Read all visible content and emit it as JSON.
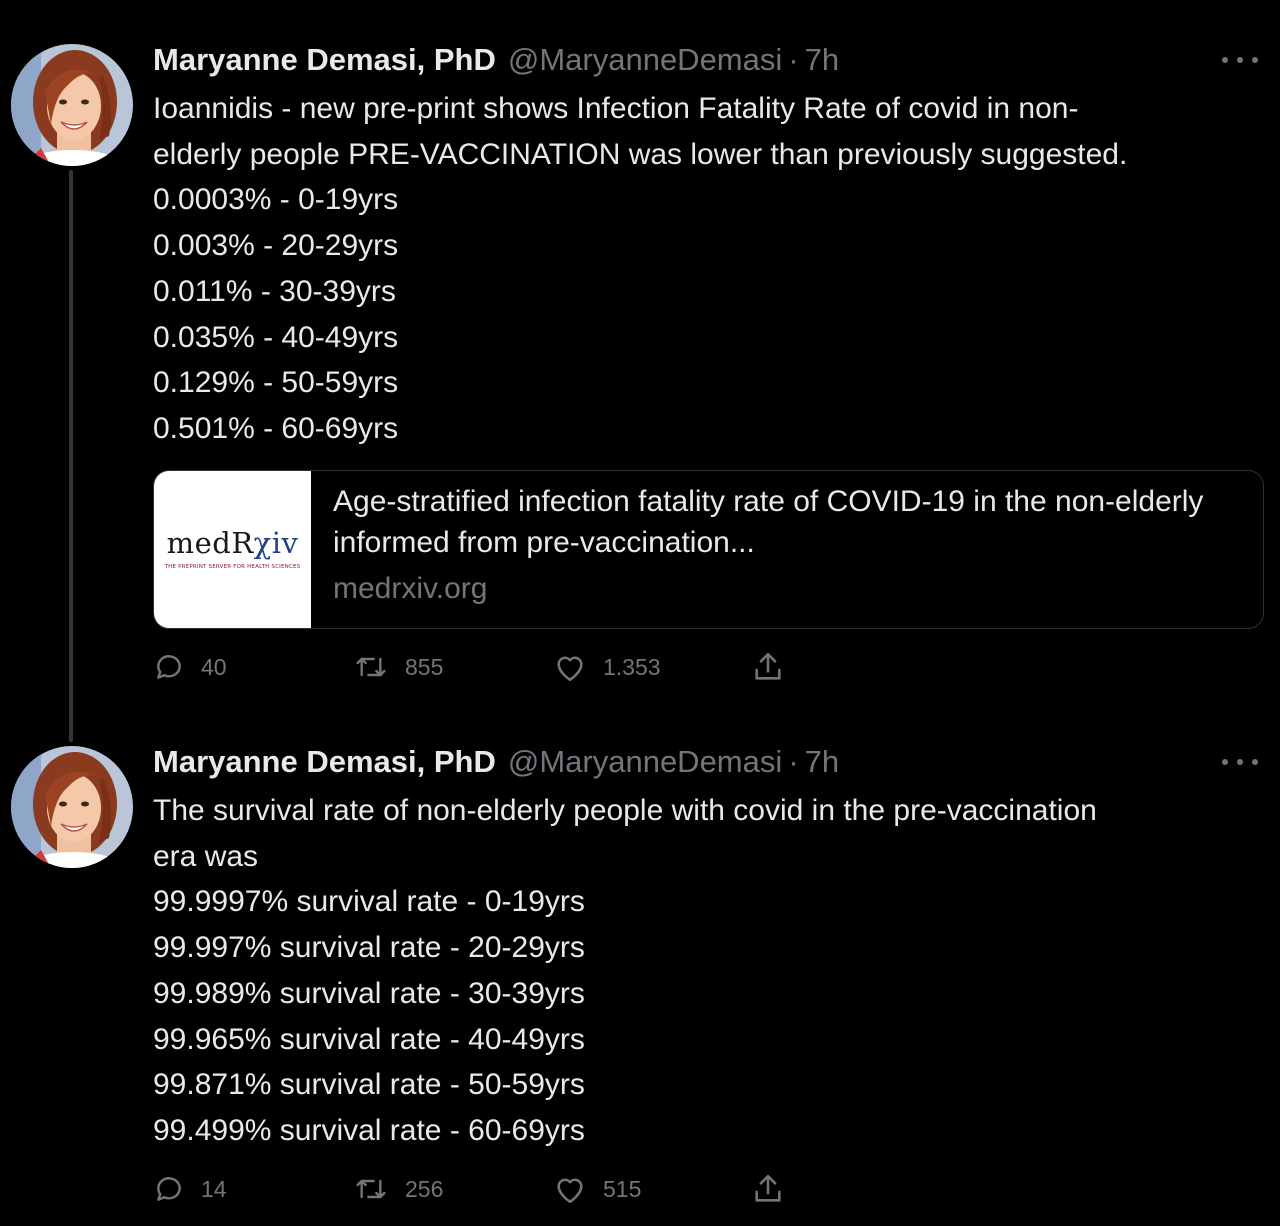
{
  "colors": {
    "background": "#000000",
    "text_primary": "#e7e9ea",
    "text_secondary": "#71767b",
    "border": "#2f3336",
    "thread_line": "#333639"
  },
  "tweets": [
    {
      "author_name": "Maryanne Demasi, PhD",
      "handle": "@MaryanneDemasi",
      "dot": "·",
      "time": "7h",
      "text_lines": [
        "Ioannidis - new pre-print shows Infection Fatality Rate of covid in non-",
        "elderly people PRE-VACCINATION was lower than previously suggested.",
        "0.0003% - 0-19yrs",
        "0.003% - 20-29yrs",
        "0.011% - 30-39yrs",
        "0.035% - 40-49yrs",
        "0.129% - 50-59yrs",
        "0.501% - 60-69yrs"
      ],
      "card": {
        "logo_main": "medR",
        "logo_accent": "χiv",
        "logo_sub": "THE PREPRINT SERVER FOR HEALTH SCIENCES",
        "title": "Age-stratified infection fatality rate of COVID-19 in the non-elderly informed from pre-vaccination...",
        "domain": "medrxiv.org"
      },
      "replies": "40",
      "retweets": "855",
      "likes": "1.353"
    },
    {
      "author_name": "Maryanne Demasi, PhD",
      "handle": "@MaryanneDemasi",
      "dot": "·",
      "time": "7h",
      "text_lines": [
        "The survival rate of non-elderly people with covid in the pre-vaccination",
        "era was",
        "99.9997% survival rate - 0-19yrs",
        "99.997% survival rate - 20-29yrs",
        "99.989% survival rate - 30-39yrs",
        "99.965% survival rate - 40-49yrs",
        "99.871% survival rate - 50-59yrs",
        "99.499% survival rate - 60-69yrs"
      ],
      "replies": "14",
      "retweets": "256",
      "likes": "515"
    }
  ],
  "icons": [
    "reply-icon",
    "retweet-icon",
    "like-icon",
    "share-icon",
    "more-icon"
  ]
}
